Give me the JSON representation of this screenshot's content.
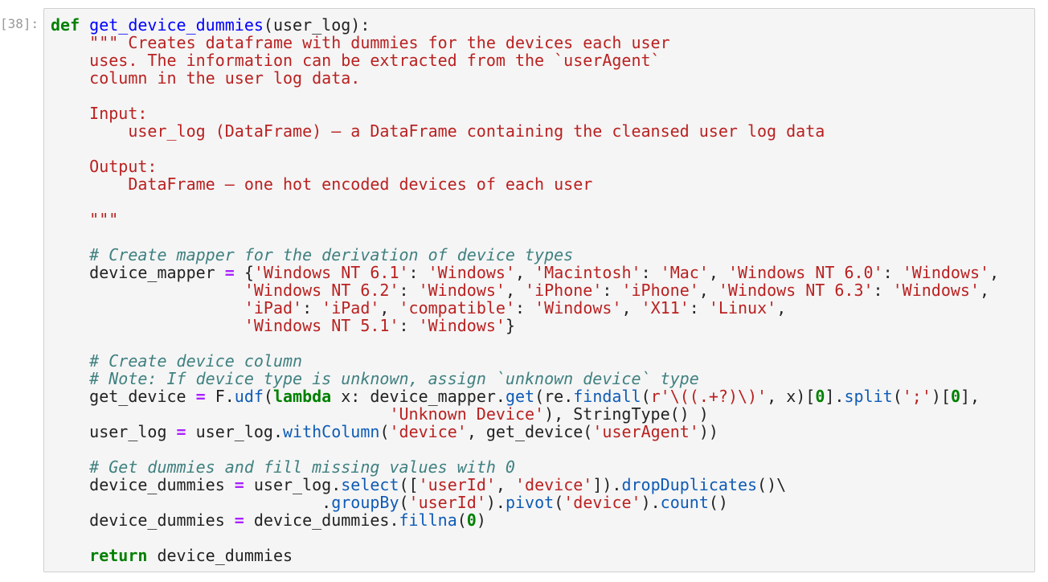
{
  "cell": {
    "prompt_label": "[38]:",
    "cell_type": "code",
    "language": "python",
    "colors": {
      "background": "#f5f5f5",
      "border": "#cfcfcf",
      "prompt_text": "#999999",
      "keyword": "#008000",
      "function_name": "#0000ff",
      "string": "#ba2121",
      "comment": "#408080",
      "number": "#008000",
      "operator": "#aa22ff",
      "property": "#0e5bb5",
      "plain_text": "#222222"
    }
  },
  "code": {
    "lines": [
      [
        {
          "t": "def",
          "c": "kw"
        },
        {
          "t": " ",
          "c": "plain"
        },
        {
          "t": "get_device_dummies",
          "c": "def"
        },
        {
          "t": "(user_log):",
          "c": "plain"
        }
      ],
      [
        {
          "t": "    \"\"\" Creates dataframe with dummies for the devices each user",
          "c": "str"
        }
      ],
      [
        {
          "t": "    uses. The information can be extracted from the `userAgent`",
          "c": "str"
        }
      ],
      [
        {
          "t": "    column in the user log data.",
          "c": "str"
        }
      ],
      [
        {
          "t": "    ",
          "c": "str"
        }
      ],
      [
        {
          "t": "    Input:",
          "c": "str"
        }
      ],
      [
        {
          "t": "        user_log (DataFrame) – a DataFrame containing the cleansed user log data",
          "c": "str"
        }
      ],
      [
        {
          "t": "    ",
          "c": "str"
        }
      ],
      [
        {
          "t": "    Output:",
          "c": "str"
        }
      ],
      [
        {
          "t": "        DataFrame – one hot encoded devices of each user",
          "c": "str"
        }
      ],
      [
        {
          "t": "    ",
          "c": "str"
        }
      ],
      [
        {
          "t": "    \"\"\"",
          "c": "str"
        }
      ],
      [
        {
          "t": "",
          "c": "plain"
        }
      ],
      [
        {
          "t": "    ",
          "c": "plain"
        },
        {
          "t": "# Create mapper for the derivation of device types",
          "c": "com"
        }
      ],
      [
        {
          "t": "    device_mapper ",
          "c": "plain"
        },
        {
          "t": "=",
          "c": "op"
        },
        {
          "t": " {",
          "c": "plain"
        },
        {
          "t": "'Windows NT 6.1'",
          "c": "str"
        },
        {
          "t": ": ",
          "c": "plain"
        },
        {
          "t": "'Windows'",
          "c": "str"
        },
        {
          "t": ", ",
          "c": "plain"
        },
        {
          "t": "'Macintosh'",
          "c": "str"
        },
        {
          "t": ": ",
          "c": "plain"
        },
        {
          "t": "'Mac'",
          "c": "str"
        },
        {
          "t": ", ",
          "c": "plain"
        },
        {
          "t": "'Windows NT 6.0'",
          "c": "str"
        },
        {
          "t": ": ",
          "c": "plain"
        },
        {
          "t": "'Windows'",
          "c": "str"
        },
        {
          "t": ",",
          "c": "plain"
        }
      ],
      [
        {
          "t": "                    ",
          "c": "plain"
        },
        {
          "t": "'Windows NT 6.2'",
          "c": "str"
        },
        {
          "t": ": ",
          "c": "plain"
        },
        {
          "t": "'Windows'",
          "c": "str"
        },
        {
          "t": ", ",
          "c": "plain"
        },
        {
          "t": "'iPhone'",
          "c": "str"
        },
        {
          "t": ": ",
          "c": "plain"
        },
        {
          "t": "'iPhone'",
          "c": "str"
        },
        {
          "t": ", ",
          "c": "plain"
        },
        {
          "t": "'Windows NT 6.3'",
          "c": "str"
        },
        {
          "t": ": ",
          "c": "plain"
        },
        {
          "t": "'Windows'",
          "c": "str"
        },
        {
          "t": ",",
          "c": "plain"
        }
      ],
      [
        {
          "t": "                    ",
          "c": "plain"
        },
        {
          "t": "'iPad'",
          "c": "str"
        },
        {
          "t": ": ",
          "c": "plain"
        },
        {
          "t": "'iPad'",
          "c": "str"
        },
        {
          "t": ", ",
          "c": "plain"
        },
        {
          "t": "'compatible'",
          "c": "str"
        },
        {
          "t": ": ",
          "c": "plain"
        },
        {
          "t": "'Windows'",
          "c": "str"
        },
        {
          "t": ", ",
          "c": "plain"
        },
        {
          "t": "'X11'",
          "c": "str"
        },
        {
          "t": ": ",
          "c": "plain"
        },
        {
          "t": "'Linux'",
          "c": "str"
        },
        {
          "t": ",",
          "c": "plain"
        }
      ],
      [
        {
          "t": "                    ",
          "c": "plain"
        },
        {
          "t": "'Windows NT 5.1'",
          "c": "str"
        },
        {
          "t": ": ",
          "c": "plain"
        },
        {
          "t": "'Windows'",
          "c": "str"
        },
        {
          "t": "}",
          "c": "plain"
        }
      ],
      [
        {
          "t": "",
          "c": "plain"
        }
      ],
      [
        {
          "t": "    ",
          "c": "plain"
        },
        {
          "t": "# Create device column",
          "c": "com"
        }
      ],
      [
        {
          "t": "    ",
          "c": "plain"
        },
        {
          "t": "# Note: If device type is unknown, assign `unknown device` type",
          "c": "com"
        }
      ],
      [
        {
          "t": "    get_device ",
          "c": "plain"
        },
        {
          "t": "=",
          "c": "op"
        },
        {
          "t": " F.",
          "c": "plain"
        },
        {
          "t": "udf",
          "c": "prop"
        },
        {
          "t": "(",
          "c": "plain"
        },
        {
          "t": "lambda",
          "c": "kw"
        },
        {
          "t": " x: device_mapper.",
          "c": "plain"
        },
        {
          "t": "get",
          "c": "prop"
        },
        {
          "t": "(re.",
          "c": "plain"
        },
        {
          "t": "findall",
          "c": "prop"
        },
        {
          "t": "(",
          "c": "plain"
        },
        {
          "t": "r'\\((.+?)\\)'",
          "c": "str"
        },
        {
          "t": ", x)[",
          "c": "plain"
        },
        {
          "t": "0",
          "c": "num"
        },
        {
          "t": "].",
          "c": "plain"
        },
        {
          "t": "split",
          "c": "prop"
        },
        {
          "t": "(",
          "c": "plain"
        },
        {
          "t": "';'",
          "c": "str"
        },
        {
          "t": ")[",
          "c": "plain"
        },
        {
          "t": "0",
          "c": "num"
        },
        {
          "t": "],",
          "c": "plain"
        }
      ],
      [
        {
          "t": "                                   ",
          "c": "plain"
        },
        {
          "t": "'Unknown Device'",
          "c": "str"
        },
        {
          "t": "), StringType() )",
          "c": "plain"
        }
      ],
      [
        {
          "t": "    user_log ",
          "c": "plain"
        },
        {
          "t": "=",
          "c": "op"
        },
        {
          "t": " user_log.",
          "c": "plain"
        },
        {
          "t": "withColumn",
          "c": "prop"
        },
        {
          "t": "(",
          "c": "plain"
        },
        {
          "t": "'device'",
          "c": "str"
        },
        {
          "t": ", get_device(",
          "c": "plain"
        },
        {
          "t": "'userAgent'",
          "c": "str"
        },
        {
          "t": "))",
          "c": "plain"
        }
      ],
      [
        {
          "t": "",
          "c": "plain"
        }
      ],
      [
        {
          "t": "    ",
          "c": "plain"
        },
        {
          "t": "# Get dummies and fill missing values with 0",
          "c": "com"
        }
      ],
      [
        {
          "t": "    device_dummies ",
          "c": "plain"
        },
        {
          "t": "=",
          "c": "op"
        },
        {
          "t": " user_log.",
          "c": "plain"
        },
        {
          "t": "select",
          "c": "prop"
        },
        {
          "t": "([",
          "c": "plain"
        },
        {
          "t": "'userId'",
          "c": "str"
        },
        {
          "t": ", ",
          "c": "plain"
        },
        {
          "t": "'device'",
          "c": "str"
        },
        {
          "t": "]).",
          "c": "plain"
        },
        {
          "t": "dropDuplicates",
          "c": "prop"
        },
        {
          "t": "()\\",
          "c": "plain"
        }
      ],
      [
        {
          "t": "                            .",
          "c": "plain"
        },
        {
          "t": "groupBy",
          "c": "prop"
        },
        {
          "t": "(",
          "c": "plain"
        },
        {
          "t": "'userId'",
          "c": "str"
        },
        {
          "t": ").",
          "c": "plain"
        },
        {
          "t": "pivot",
          "c": "prop"
        },
        {
          "t": "(",
          "c": "plain"
        },
        {
          "t": "'device'",
          "c": "str"
        },
        {
          "t": ").",
          "c": "plain"
        },
        {
          "t": "count",
          "c": "prop"
        },
        {
          "t": "()",
          "c": "plain"
        }
      ],
      [
        {
          "t": "    device_dummies ",
          "c": "plain"
        },
        {
          "t": "=",
          "c": "op"
        },
        {
          "t": " device_dummies.",
          "c": "plain"
        },
        {
          "t": "fillna",
          "c": "prop"
        },
        {
          "t": "(",
          "c": "plain"
        },
        {
          "t": "0",
          "c": "num"
        },
        {
          "t": ")",
          "c": "plain"
        }
      ],
      [
        {
          "t": "",
          "c": "plain"
        }
      ],
      [
        {
          "t": "    ",
          "c": "plain"
        },
        {
          "t": "return",
          "c": "kw"
        },
        {
          "t": " device_dummies",
          "c": "plain"
        }
      ]
    ],
    "plain_source": "def get_device_dummies(user_log):\n    \"\"\" Creates dataframe with dummies for the devices each user\n    uses. The information can be extracted from the `userAgent`\n    column in the user log data.\n\n    Input:\n        user_log (DataFrame) – a DataFrame containing the cleansed user log data\n\n    Output:\n        DataFrame – one hot encoded devices of each user\n\n    \"\"\"\n\n    # Create mapper for the derivation of device types\n    device_mapper = {'Windows NT 6.1': 'Windows', 'Macintosh': 'Mac', 'Windows NT 6.0': 'Windows',\n                    'Windows NT 6.2': 'Windows', 'iPhone': 'iPhone', 'Windows NT 6.3': 'Windows',\n                    'iPad': 'iPad', 'compatible': 'Windows', 'X11': 'Linux',\n                    'Windows NT 5.1': 'Windows'}\n\n    # Create device column\n    # Note: If device type is unknown, assign `unknown device` type\n    get_device = F.udf(lambda x: device_mapper.get(re.findall(r'\\((.+?)\\)', x)[0].split(';')[0],\n                                   'Unknown Device'), StringType() )\n    user_log = user_log.withColumn('device', get_device('userAgent'))\n\n    # Get dummies and fill missing values with 0\n    device_dummies = user_log.select(['userId', 'device']).dropDuplicates()\\\n                            .groupBy('userId').pivot('device').count()\n    device_dummies = device_dummies.fillna(0)\n\n    return device_dummies"
  }
}
